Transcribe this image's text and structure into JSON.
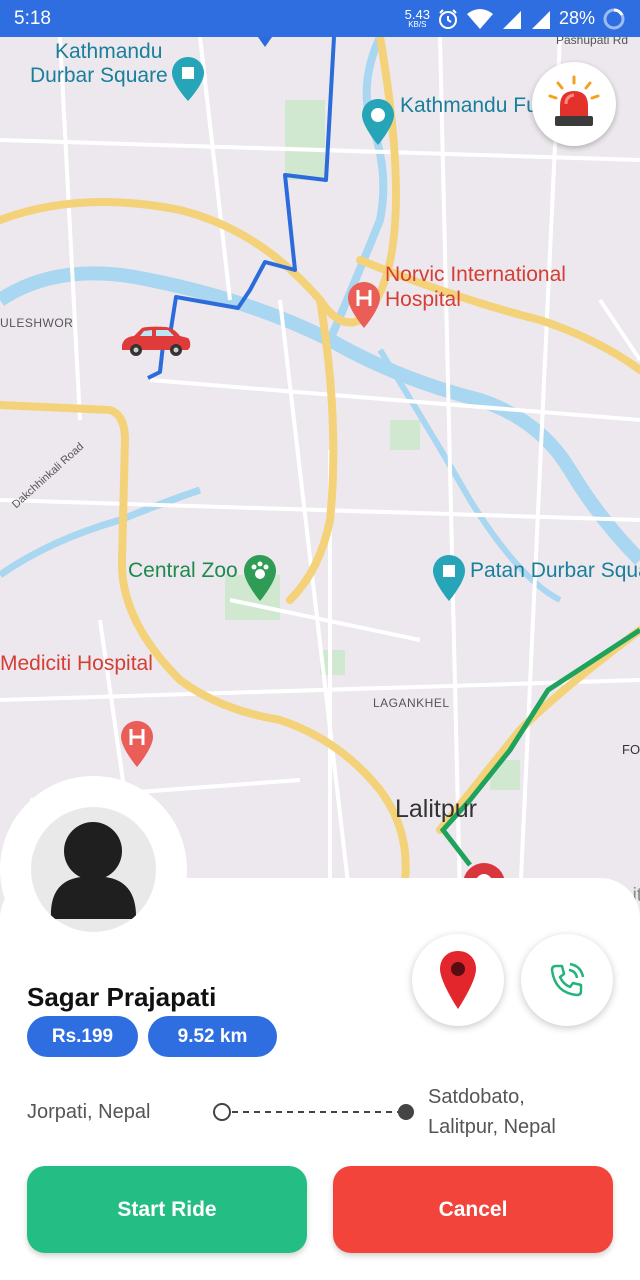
{
  "status_bar": {
    "time": "5:18",
    "net_speed": "5.43",
    "net_speed_unit": "KB/S",
    "battery": "28%"
  },
  "map": {
    "labels": {
      "kathmandu_durbar": [
        "Kathmandu",
        "Durbar Square"
      ],
      "kathmandu_fun": "Kathmandu Fu",
      "norvic": [
        "Norvic International",
        "Hospital"
      ],
      "kaleshwor": "ULESHWOR",
      "dakchhinkali": "Dakchhinkali Road",
      "central_zoo": "Central Zoo",
      "patan_durbar": "Patan Durbar Squa",
      "mediciti": "Mediciti Hospital",
      "lagankhel": "LAGANKHEL",
      "lalitpur": "Lalitpur",
      "pashupati": "Pashupati Rd",
      "fo": "FO",
      "lit": "Lit"
    },
    "colors": {
      "route": "#2c6bdb",
      "traffic": "#1fa35c",
      "road": "#f7d97a",
      "water": "#a9d6f0"
    }
  },
  "driver": {
    "name": "Sagar Prajapati",
    "fare": "Rs.199",
    "distance": "9.52 km"
  },
  "trip": {
    "from": "Jorpati, Nepal",
    "to": [
      "Satdobato,",
      "Lalitpur, Nepal"
    ]
  },
  "actions": {
    "start": "Start Ride",
    "cancel": "Cancel"
  },
  "icons": {
    "siren": "siren-icon",
    "location": "location-pin-icon",
    "call": "phone-call-icon",
    "avatar": "person-icon",
    "car": "car-icon"
  }
}
